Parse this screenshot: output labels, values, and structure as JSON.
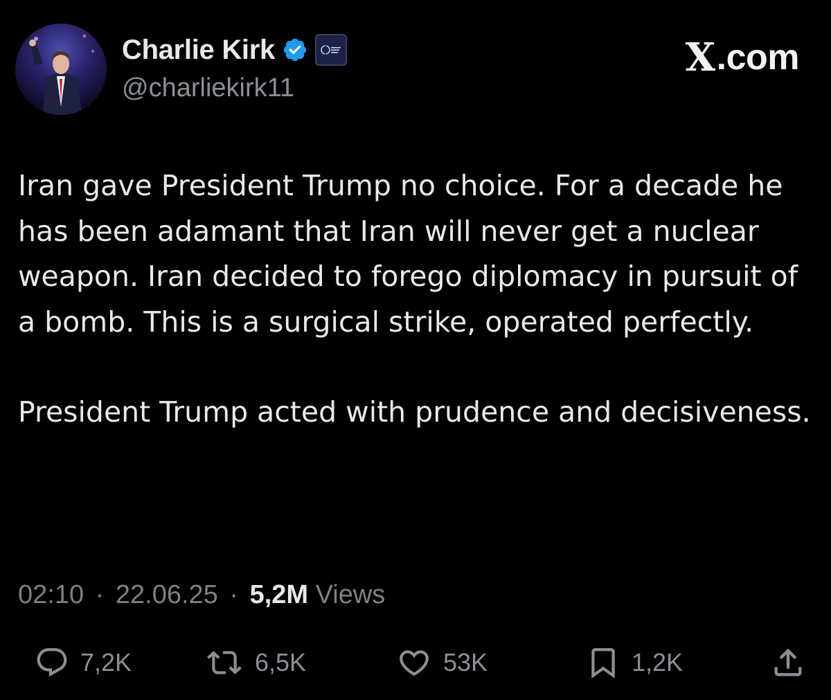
{
  "author": {
    "display_name": "Charlie Kirk",
    "handle": "@charliekirk11"
  },
  "brand": {
    "site": ".com",
    "x_mark": "X"
  },
  "tweet": {
    "paragraphs": [
      "Iran gave President Trump no choice. For a decade he has been adamant that Iran will never get a nuclear weapon. Iran decided to forego diplomacy in pursuit of a bomb. This is a surgical strike, operated perfectly.",
      "President Trump acted with prudence and decisiveness."
    ]
  },
  "meta": {
    "time": "02:10",
    "date": "22.06.25",
    "separator": "·",
    "views_count": "5,2M",
    "views_label": "Views"
  },
  "actions": {
    "replies": "7,2K",
    "reposts": "6,5K",
    "likes": "53K",
    "bookmarks": "1,2K"
  },
  "colors": {
    "background": "#000000",
    "text": "#e7e9ea",
    "secondary": "#8b9096",
    "verified": "#1d9bf0"
  },
  "icons": {
    "verified": "verified-badge-icon",
    "affiliate": "organization-badge-icon",
    "reply": "speech-bubble-icon",
    "repost": "repost-arrows-icon",
    "like": "heart-icon",
    "bookmark": "bookmark-icon",
    "share": "share-upload-icon"
  }
}
